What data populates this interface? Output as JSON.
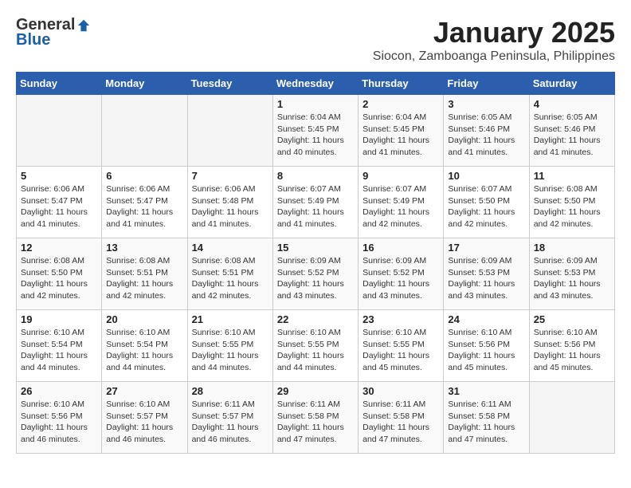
{
  "header": {
    "logo_general": "General",
    "logo_blue": "Blue",
    "month_title": "January 2025",
    "subtitle": "Siocon, Zamboanga Peninsula, Philippines"
  },
  "days_of_week": [
    "Sunday",
    "Monday",
    "Tuesday",
    "Wednesday",
    "Thursday",
    "Friday",
    "Saturday"
  ],
  "weeks": [
    [
      {
        "day": "",
        "sunrise": "",
        "sunset": "",
        "daylight": ""
      },
      {
        "day": "",
        "sunrise": "",
        "sunset": "",
        "daylight": ""
      },
      {
        "day": "",
        "sunrise": "",
        "sunset": "",
        "daylight": ""
      },
      {
        "day": "1",
        "sunrise": "Sunrise: 6:04 AM",
        "sunset": "Sunset: 5:45 PM",
        "daylight": "Daylight: 11 hours and 40 minutes."
      },
      {
        "day": "2",
        "sunrise": "Sunrise: 6:04 AM",
        "sunset": "Sunset: 5:45 PM",
        "daylight": "Daylight: 11 hours and 41 minutes."
      },
      {
        "day": "3",
        "sunrise": "Sunrise: 6:05 AM",
        "sunset": "Sunset: 5:46 PM",
        "daylight": "Daylight: 11 hours and 41 minutes."
      },
      {
        "day": "4",
        "sunrise": "Sunrise: 6:05 AM",
        "sunset": "Sunset: 5:46 PM",
        "daylight": "Daylight: 11 hours and 41 minutes."
      }
    ],
    [
      {
        "day": "5",
        "sunrise": "Sunrise: 6:06 AM",
        "sunset": "Sunset: 5:47 PM",
        "daylight": "Daylight: 11 hours and 41 minutes."
      },
      {
        "day": "6",
        "sunrise": "Sunrise: 6:06 AM",
        "sunset": "Sunset: 5:47 PM",
        "daylight": "Daylight: 11 hours and 41 minutes."
      },
      {
        "day": "7",
        "sunrise": "Sunrise: 6:06 AM",
        "sunset": "Sunset: 5:48 PM",
        "daylight": "Daylight: 11 hours and 41 minutes."
      },
      {
        "day": "8",
        "sunrise": "Sunrise: 6:07 AM",
        "sunset": "Sunset: 5:49 PM",
        "daylight": "Daylight: 11 hours and 41 minutes."
      },
      {
        "day": "9",
        "sunrise": "Sunrise: 6:07 AM",
        "sunset": "Sunset: 5:49 PM",
        "daylight": "Daylight: 11 hours and 42 minutes."
      },
      {
        "day": "10",
        "sunrise": "Sunrise: 6:07 AM",
        "sunset": "Sunset: 5:50 PM",
        "daylight": "Daylight: 11 hours and 42 minutes."
      },
      {
        "day": "11",
        "sunrise": "Sunrise: 6:08 AM",
        "sunset": "Sunset: 5:50 PM",
        "daylight": "Daylight: 11 hours and 42 minutes."
      }
    ],
    [
      {
        "day": "12",
        "sunrise": "Sunrise: 6:08 AM",
        "sunset": "Sunset: 5:50 PM",
        "daylight": "Daylight: 11 hours and 42 minutes."
      },
      {
        "day": "13",
        "sunrise": "Sunrise: 6:08 AM",
        "sunset": "Sunset: 5:51 PM",
        "daylight": "Daylight: 11 hours and 42 minutes."
      },
      {
        "day": "14",
        "sunrise": "Sunrise: 6:08 AM",
        "sunset": "Sunset: 5:51 PM",
        "daylight": "Daylight: 11 hours and 42 minutes."
      },
      {
        "day": "15",
        "sunrise": "Sunrise: 6:09 AM",
        "sunset": "Sunset: 5:52 PM",
        "daylight": "Daylight: 11 hours and 43 minutes."
      },
      {
        "day": "16",
        "sunrise": "Sunrise: 6:09 AM",
        "sunset": "Sunset: 5:52 PM",
        "daylight": "Daylight: 11 hours and 43 minutes."
      },
      {
        "day": "17",
        "sunrise": "Sunrise: 6:09 AM",
        "sunset": "Sunset: 5:53 PM",
        "daylight": "Daylight: 11 hours and 43 minutes."
      },
      {
        "day": "18",
        "sunrise": "Sunrise: 6:09 AM",
        "sunset": "Sunset: 5:53 PM",
        "daylight": "Daylight: 11 hours and 43 minutes."
      }
    ],
    [
      {
        "day": "19",
        "sunrise": "Sunrise: 6:10 AM",
        "sunset": "Sunset: 5:54 PM",
        "daylight": "Daylight: 11 hours and 44 minutes."
      },
      {
        "day": "20",
        "sunrise": "Sunrise: 6:10 AM",
        "sunset": "Sunset: 5:54 PM",
        "daylight": "Daylight: 11 hours and 44 minutes."
      },
      {
        "day": "21",
        "sunrise": "Sunrise: 6:10 AM",
        "sunset": "Sunset: 5:55 PM",
        "daylight": "Daylight: 11 hours and 44 minutes."
      },
      {
        "day": "22",
        "sunrise": "Sunrise: 6:10 AM",
        "sunset": "Sunset: 5:55 PM",
        "daylight": "Daylight: 11 hours and 44 minutes."
      },
      {
        "day": "23",
        "sunrise": "Sunrise: 6:10 AM",
        "sunset": "Sunset: 5:55 PM",
        "daylight": "Daylight: 11 hours and 45 minutes."
      },
      {
        "day": "24",
        "sunrise": "Sunrise: 6:10 AM",
        "sunset": "Sunset: 5:56 PM",
        "daylight": "Daylight: 11 hours and 45 minutes."
      },
      {
        "day": "25",
        "sunrise": "Sunrise: 6:10 AM",
        "sunset": "Sunset: 5:56 PM",
        "daylight": "Daylight: 11 hours and 45 minutes."
      }
    ],
    [
      {
        "day": "26",
        "sunrise": "Sunrise: 6:10 AM",
        "sunset": "Sunset: 5:56 PM",
        "daylight": "Daylight: 11 hours and 46 minutes."
      },
      {
        "day": "27",
        "sunrise": "Sunrise: 6:10 AM",
        "sunset": "Sunset: 5:57 PM",
        "daylight": "Daylight: 11 hours and 46 minutes."
      },
      {
        "day": "28",
        "sunrise": "Sunrise: 6:11 AM",
        "sunset": "Sunset: 5:57 PM",
        "daylight": "Daylight: 11 hours and 46 minutes."
      },
      {
        "day": "29",
        "sunrise": "Sunrise: 6:11 AM",
        "sunset": "Sunset: 5:58 PM",
        "daylight": "Daylight: 11 hours and 47 minutes."
      },
      {
        "day": "30",
        "sunrise": "Sunrise: 6:11 AM",
        "sunset": "Sunset: 5:58 PM",
        "daylight": "Daylight: 11 hours and 47 minutes."
      },
      {
        "day": "31",
        "sunrise": "Sunrise: 6:11 AM",
        "sunset": "Sunset: 5:58 PM",
        "daylight": "Daylight: 11 hours and 47 minutes."
      },
      {
        "day": "",
        "sunrise": "",
        "sunset": "",
        "daylight": ""
      }
    ]
  ]
}
